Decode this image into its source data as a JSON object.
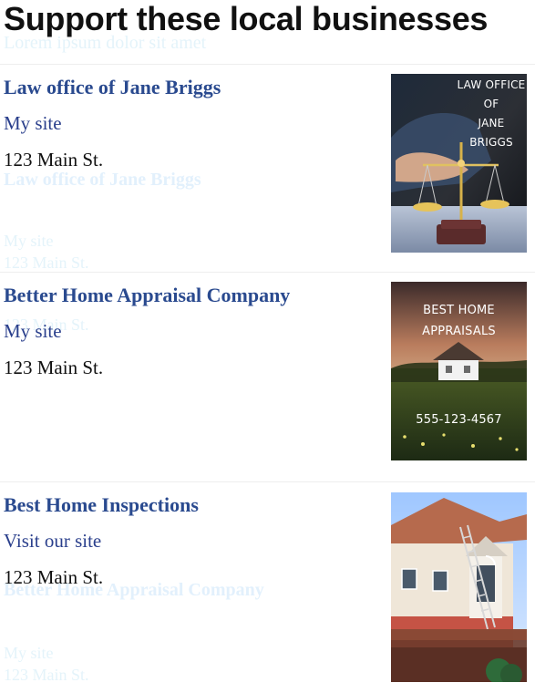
{
  "page": {
    "title": "Support these local businesses"
  },
  "listings": [
    {
      "name": "Law office of Jane Briggs",
      "link_label": "My site",
      "address": "123 Main St.",
      "image": {
        "caption": "LAW OFFICE\nOF\nJANE BRIGGS"
      }
    },
    {
      "name": "Better Home Appraisal Company",
      "link_label": "My site",
      "address": "123 Main St.",
      "image": {
        "caption": "BEST HOME\nAPPRAISALS",
        "phone": "555-123-4567"
      }
    },
    {
      "name": "Best Home Inspections",
      "link_label": "Visit our site",
      "address": "123 Main St.",
      "image": {
        "caption": ""
      }
    }
  ],
  "theme": {
    "link_color": "#2a4a8f",
    "text_color": "#111111",
    "divider_color": "#eeeeee"
  }
}
